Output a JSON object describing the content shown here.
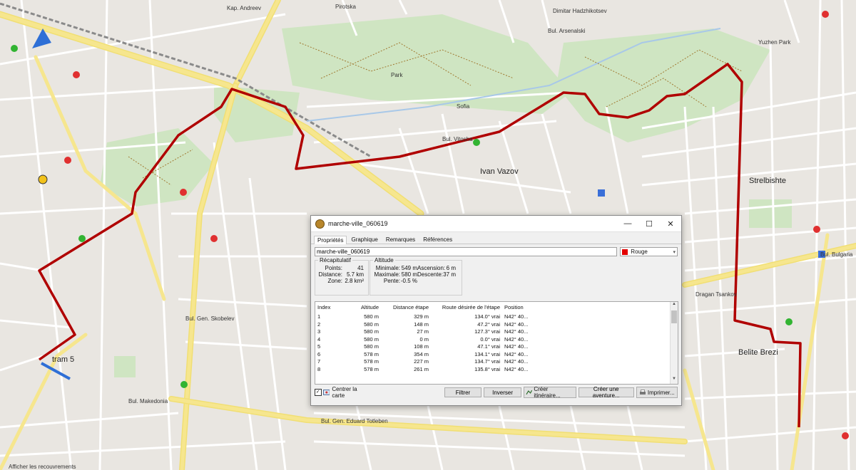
{
  "map": {
    "labels": {
      "kap_andreev": "Kap. Andreev",
      "pirotska": "Pirotska",
      "dimitar_hadzhikotsev": "Dimitar Hadzhikotsev",
      "bul_arsenalski": "Bul. Arsenalski",
      "yuzhen_park": "Yuzhen Park",
      "park": "Park",
      "sofia": "Sofia",
      "ivan_vazov": "Ivan Vazov",
      "strelbishte": "Strelbishte",
      "belite_brezi": "Belite Brezi",
      "bul_vitosha": "Bul. Vitosha",
      "bul_bulgaria": "Bul. Bulgaria",
      "gen_eduard_totleben": "Bul. Gen. Eduard Totleben",
      "bul_makedonia": "Bul. Makedonia",
      "bul_skobelev": "Bul. Gen. Skobelev",
      "dragan_tsankov": "Dragan Tsankov",
      "tram": "tram 5",
      "bottom_hint": "Afficher les recouvrements"
    }
  },
  "dialog": {
    "title": "marche-ville_060619",
    "tabs": [
      "Propriétés",
      "Graphique",
      "Remarques",
      "Références"
    ],
    "name_value": "marche-ville_060619",
    "color": {
      "label": "Rouge",
      "hex": "#e30000"
    },
    "recap": {
      "legend": "Récapitulatif",
      "points_label": "Points:",
      "points_value": "41",
      "distance_label": "Distance:",
      "distance_value": "5.7 km",
      "zone_label": "Zone:",
      "zone_value": "2.8 km²"
    },
    "altitude": {
      "legend": "Altitude",
      "min_label": "Minimale:",
      "min_value": "549 m",
      "max_label": "Maximale:",
      "max_value": "580 m",
      "slope_label": "Pente:",
      "slope_value": "-0.5 %",
      "asc_label": "Ascension:",
      "asc_value": "6 m",
      "desc_label": "Descente:",
      "desc_value": "37 m"
    },
    "table": {
      "headers": [
        "Index",
        "Altitude",
        "Distance étape",
        "Route désirée de l'étape",
        "Position"
      ],
      "rows": [
        [
          "1",
          "580 m",
          "329 m",
          "134.0° vrai",
          "N42° 40..."
        ],
        [
          "2",
          "580 m",
          "148 m",
          "47.2° vrai",
          "N42° 40..."
        ],
        [
          "3",
          "580 m",
          "27 m",
          "127.3° vrai",
          "N42° 40..."
        ],
        [
          "4",
          "580 m",
          "0 m",
          "0.0° vrai",
          "N42° 40..."
        ],
        [
          "5",
          "580 m",
          "108 m",
          "47.1° vrai",
          "N42° 40..."
        ],
        [
          "6",
          "578 m",
          "354 m",
          "134.1° vrai",
          "N42° 40..."
        ],
        [
          "7",
          "578 m",
          "227 m",
          "134.7° vrai",
          "N42° 40..."
        ],
        [
          "8",
          "578 m",
          "261 m",
          "135.8° vrai",
          "N42° 40..."
        ]
      ]
    },
    "center_map": "Centrer la carte",
    "buttons": {
      "filter": "Filtrer",
      "reverse": "Inverser",
      "create_route": "Créer itinéraire...",
      "create_adventure": "Créer une aventure...",
      "print": "Imprimer..."
    }
  }
}
